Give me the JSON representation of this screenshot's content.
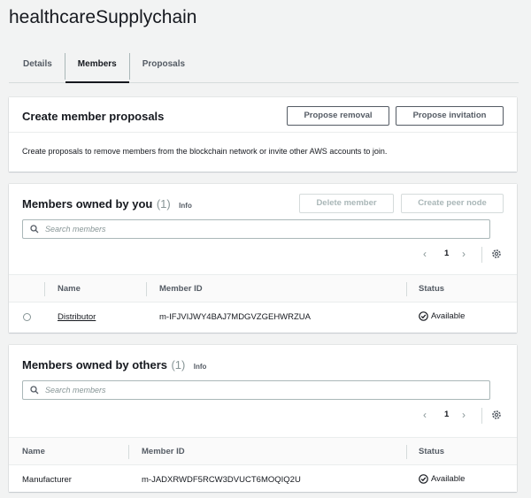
{
  "page_title": "healthcareSupplychain",
  "tabs": [
    {
      "label": "Details"
    },
    {
      "label": "Members"
    },
    {
      "label": "Proposals"
    }
  ],
  "proposals_panel": {
    "title": "Create member proposals",
    "propose_removal_label": "Propose removal",
    "propose_invitation_label": "Propose invitation",
    "description": "Create proposals to remove members from the blockchain network or invite other AWS accounts to join."
  },
  "owned_by_you": {
    "title": "Members owned by you",
    "count": "(1)",
    "info": "Info",
    "delete_label": "Delete member",
    "create_peer_label": "Create peer node",
    "search_placeholder": "Search members",
    "page": "1",
    "columns": [
      "Name",
      "Member ID",
      "Status"
    ],
    "rows": [
      {
        "name": "Distributor",
        "member_id": "m-IFJVIJWY4BAJ7MDGVZGEHWRZUA",
        "status": "Available"
      }
    ]
  },
  "owned_by_others": {
    "title": "Members owned by others",
    "count": "(1)",
    "info": "Info",
    "search_placeholder": "Search members",
    "page": "1",
    "columns": [
      "Name",
      "Member ID",
      "Status"
    ],
    "rows": [
      {
        "name": "Manufacturer",
        "member_id": "m-JADXRWDF5RCW3DVUCT6MOQIQ2U",
        "status": "Available"
      }
    ]
  },
  "colors": {
    "background": "#f2f3f3",
    "panel": "#ffffff",
    "text": "#16191f",
    "muted": "#545b64"
  }
}
